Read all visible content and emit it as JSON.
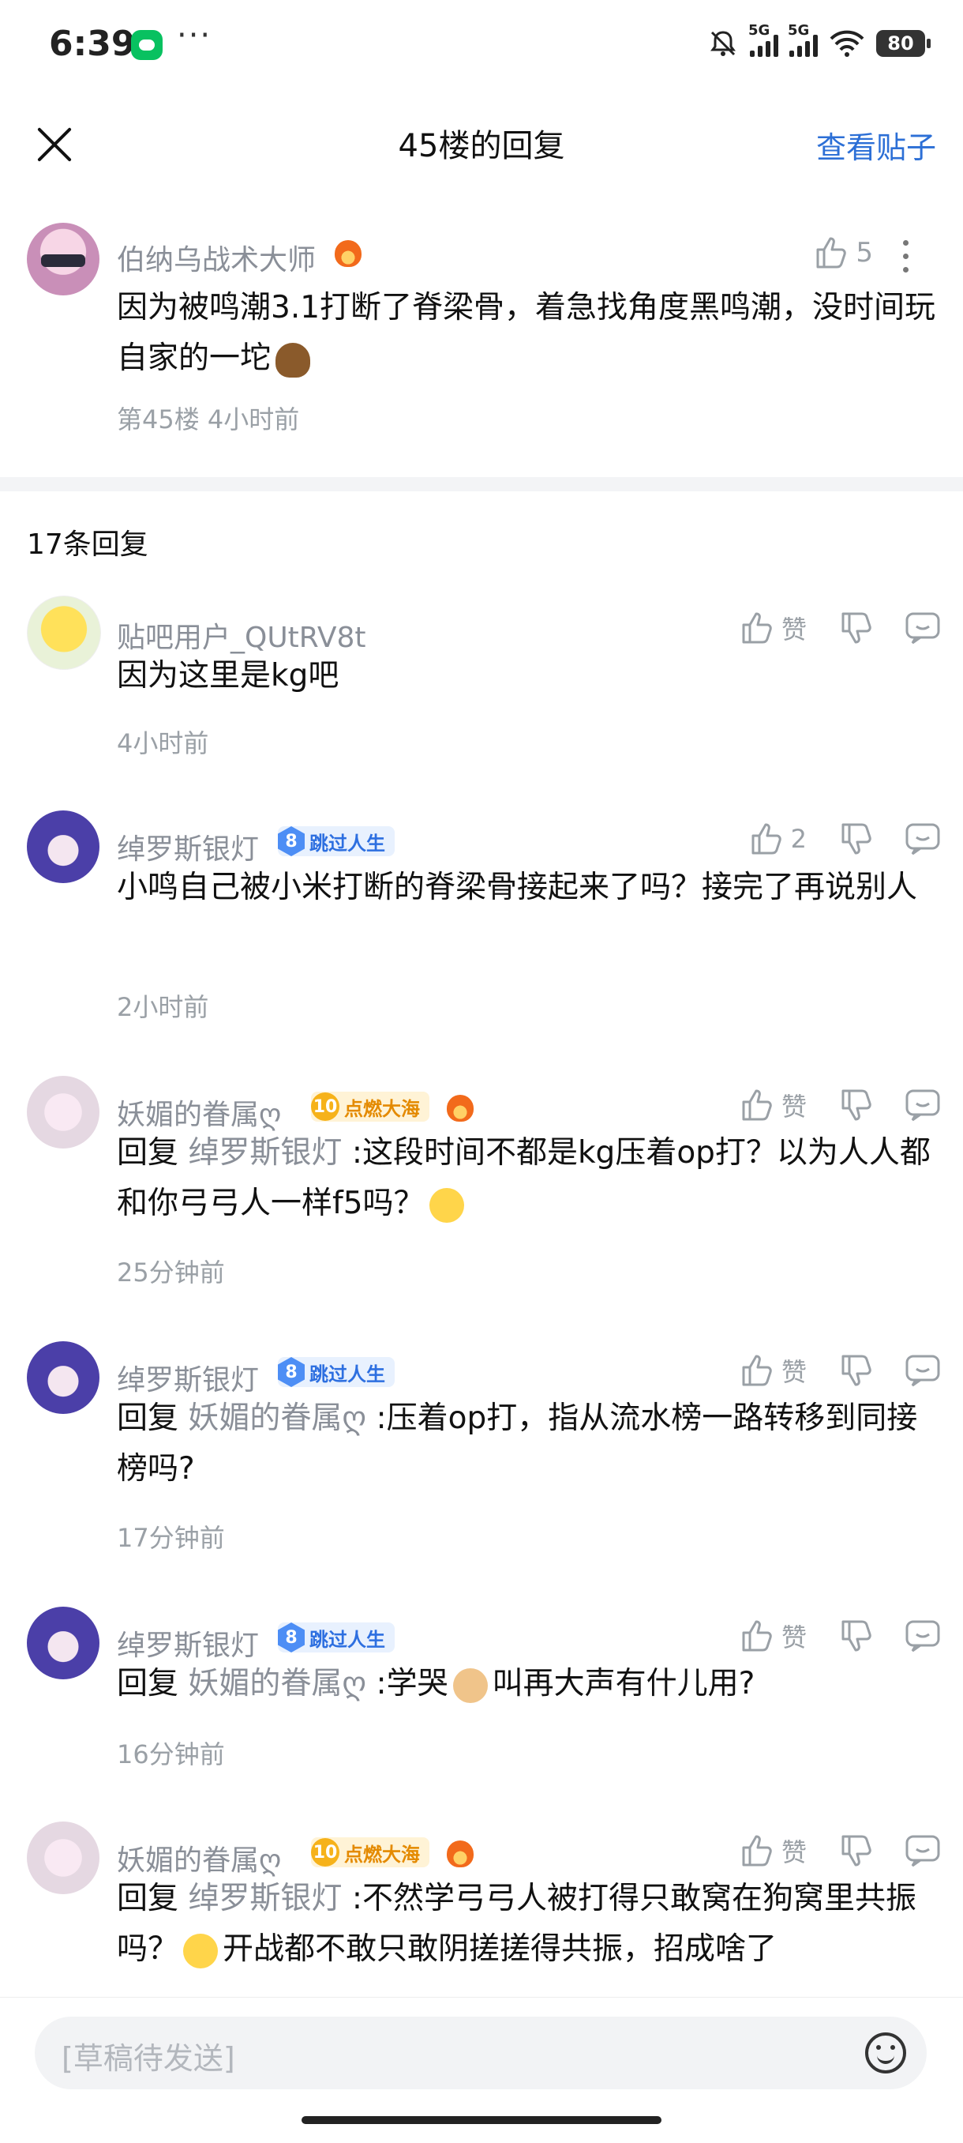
{
  "status_bar": {
    "time": "6:39",
    "signal1_label": "5G",
    "signal2_label": "5G",
    "battery": "80"
  },
  "header": {
    "title": "45楼的回复",
    "view_post": "查看贴子"
  },
  "main_post": {
    "author": "伯纳乌战术大师",
    "likes": "5",
    "content": "因为被鸣潮3.1打断了脊梁骨，着急找角度黑鸣潮，没时间玩自家的一坨",
    "meta": "第45楼 4小时前"
  },
  "reply_count": "17条回复",
  "like_label": "赞",
  "reply_prefix": "回复",
  "replies": [
    {
      "author": "贴吧用户_QUtRV8t",
      "like": "赞",
      "content": "因为这里是kg吧",
      "time": "4小时前"
    },
    {
      "author": "绰罗斯银灯",
      "badge_level": "8",
      "badge_text": "跳过人生",
      "like": "2",
      "content": "小鸣自己被小米打断的脊梁骨接起来了吗？接完了再说别人",
      "time": "2小时前"
    },
    {
      "author": "妖媚的眷属ღ",
      "badge_level": "10",
      "badge_text": "点燃大海",
      "like": "赞",
      "reply_to": "绰罗斯银灯",
      "content": " :这段时间不都是kg压着op打？以为人人都和你弓弓人一样f5吗？",
      "time": "25分钟前"
    },
    {
      "author": "绰罗斯银灯",
      "badge_level": "8",
      "badge_text": "跳过人生",
      "like": "赞",
      "reply_to": "妖媚的眷属ღ",
      "content": " :压着op打，指从流水榜一路转移到同接榜吗?",
      "time": "17分钟前"
    },
    {
      "author": "绰罗斯银灯",
      "badge_level": "8",
      "badge_text": "跳过人生",
      "like": "赞",
      "reply_to": "妖媚的眷属ღ",
      "content_a": " :学哭",
      "content_b": "叫再大声有什儿用?",
      "time": "16分钟前"
    },
    {
      "author": "妖媚的眷属ღ",
      "badge_level": "10",
      "badge_text": "点燃大海",
      "like": "赞",
      "reply_to": "绰罗斯银灯",
      "content_a": " :不然学弓弓人被打得只敢窝在狗窝里共振吗？",
      "content_b": "开战都不敢只敢阴搓搓得共振，招成啥了"
    }
  ],
  "input": {
    "placeholder": "[草稿待发送]"
  }
}
